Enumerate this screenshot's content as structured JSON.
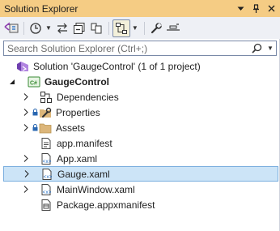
{
  "window": {
    "title": "Solution Explorer",
    "title_bar_color": "#f5cc84",
    "buttons": [
      "chevron-down-icon",
      "pin-icon",
      "close-icon"
    ]
  },
  "toolbar": {
    "icons": [
      "switch-views-icon",
      "history-icon",
      "back-forward-icon",
      "collapse-all-icon",
      "show-all-files-icon",
      "sync-active-doc-icon",
      "properties-wrench-icon",
      "preview-selected-icon"
    ]
  },
  "search": {
    "placeholder": "Search Solution Explorer (Ctrl+;)"
  },
  "tree": {
    "solution": "Solution 'GaugeControl' (1 of 1 project)",
    "project": "GaugeControl",
    "items": [
      {
        "label": "Dependencies",
        "icon": "dependencies-icon",
        "expandable": true,
        "locked": false
      },
      {
        "label": "Properties",
        "icon": "properties-icon",
        "expandable": true,
        "locked": true
      },
      {
        "label": "Assets",
        "icon": "folder-icon",
        "expandable": true,
        "locked": true
      },
      {
        "label": "app.manifest",
        "icon": "manifest-icon",
        "expandable": false,
        "locked": false
      },
      {
        "label": "App.xaml",
        "icon": "xaml-icon",
        "expandable": true,
        "locked": false
      },
      {
        "label": "Gauge.xaml",
        "icon": "xaml-icon",
        "expandable": true,
        "locked": false,
        "selected": true
      },
      {
        "label": "MainWindow.xaml",
        "icon": "xaml-icon",
        "expandable": true,
        "locked": false
      },
      {
        "label": "Package.appxmanifest",
        "icon": "package-icon",
        "expandable": false,
        "locked": false
      }
    ],
    "selection_color": "#cce4f7"
  }
}
